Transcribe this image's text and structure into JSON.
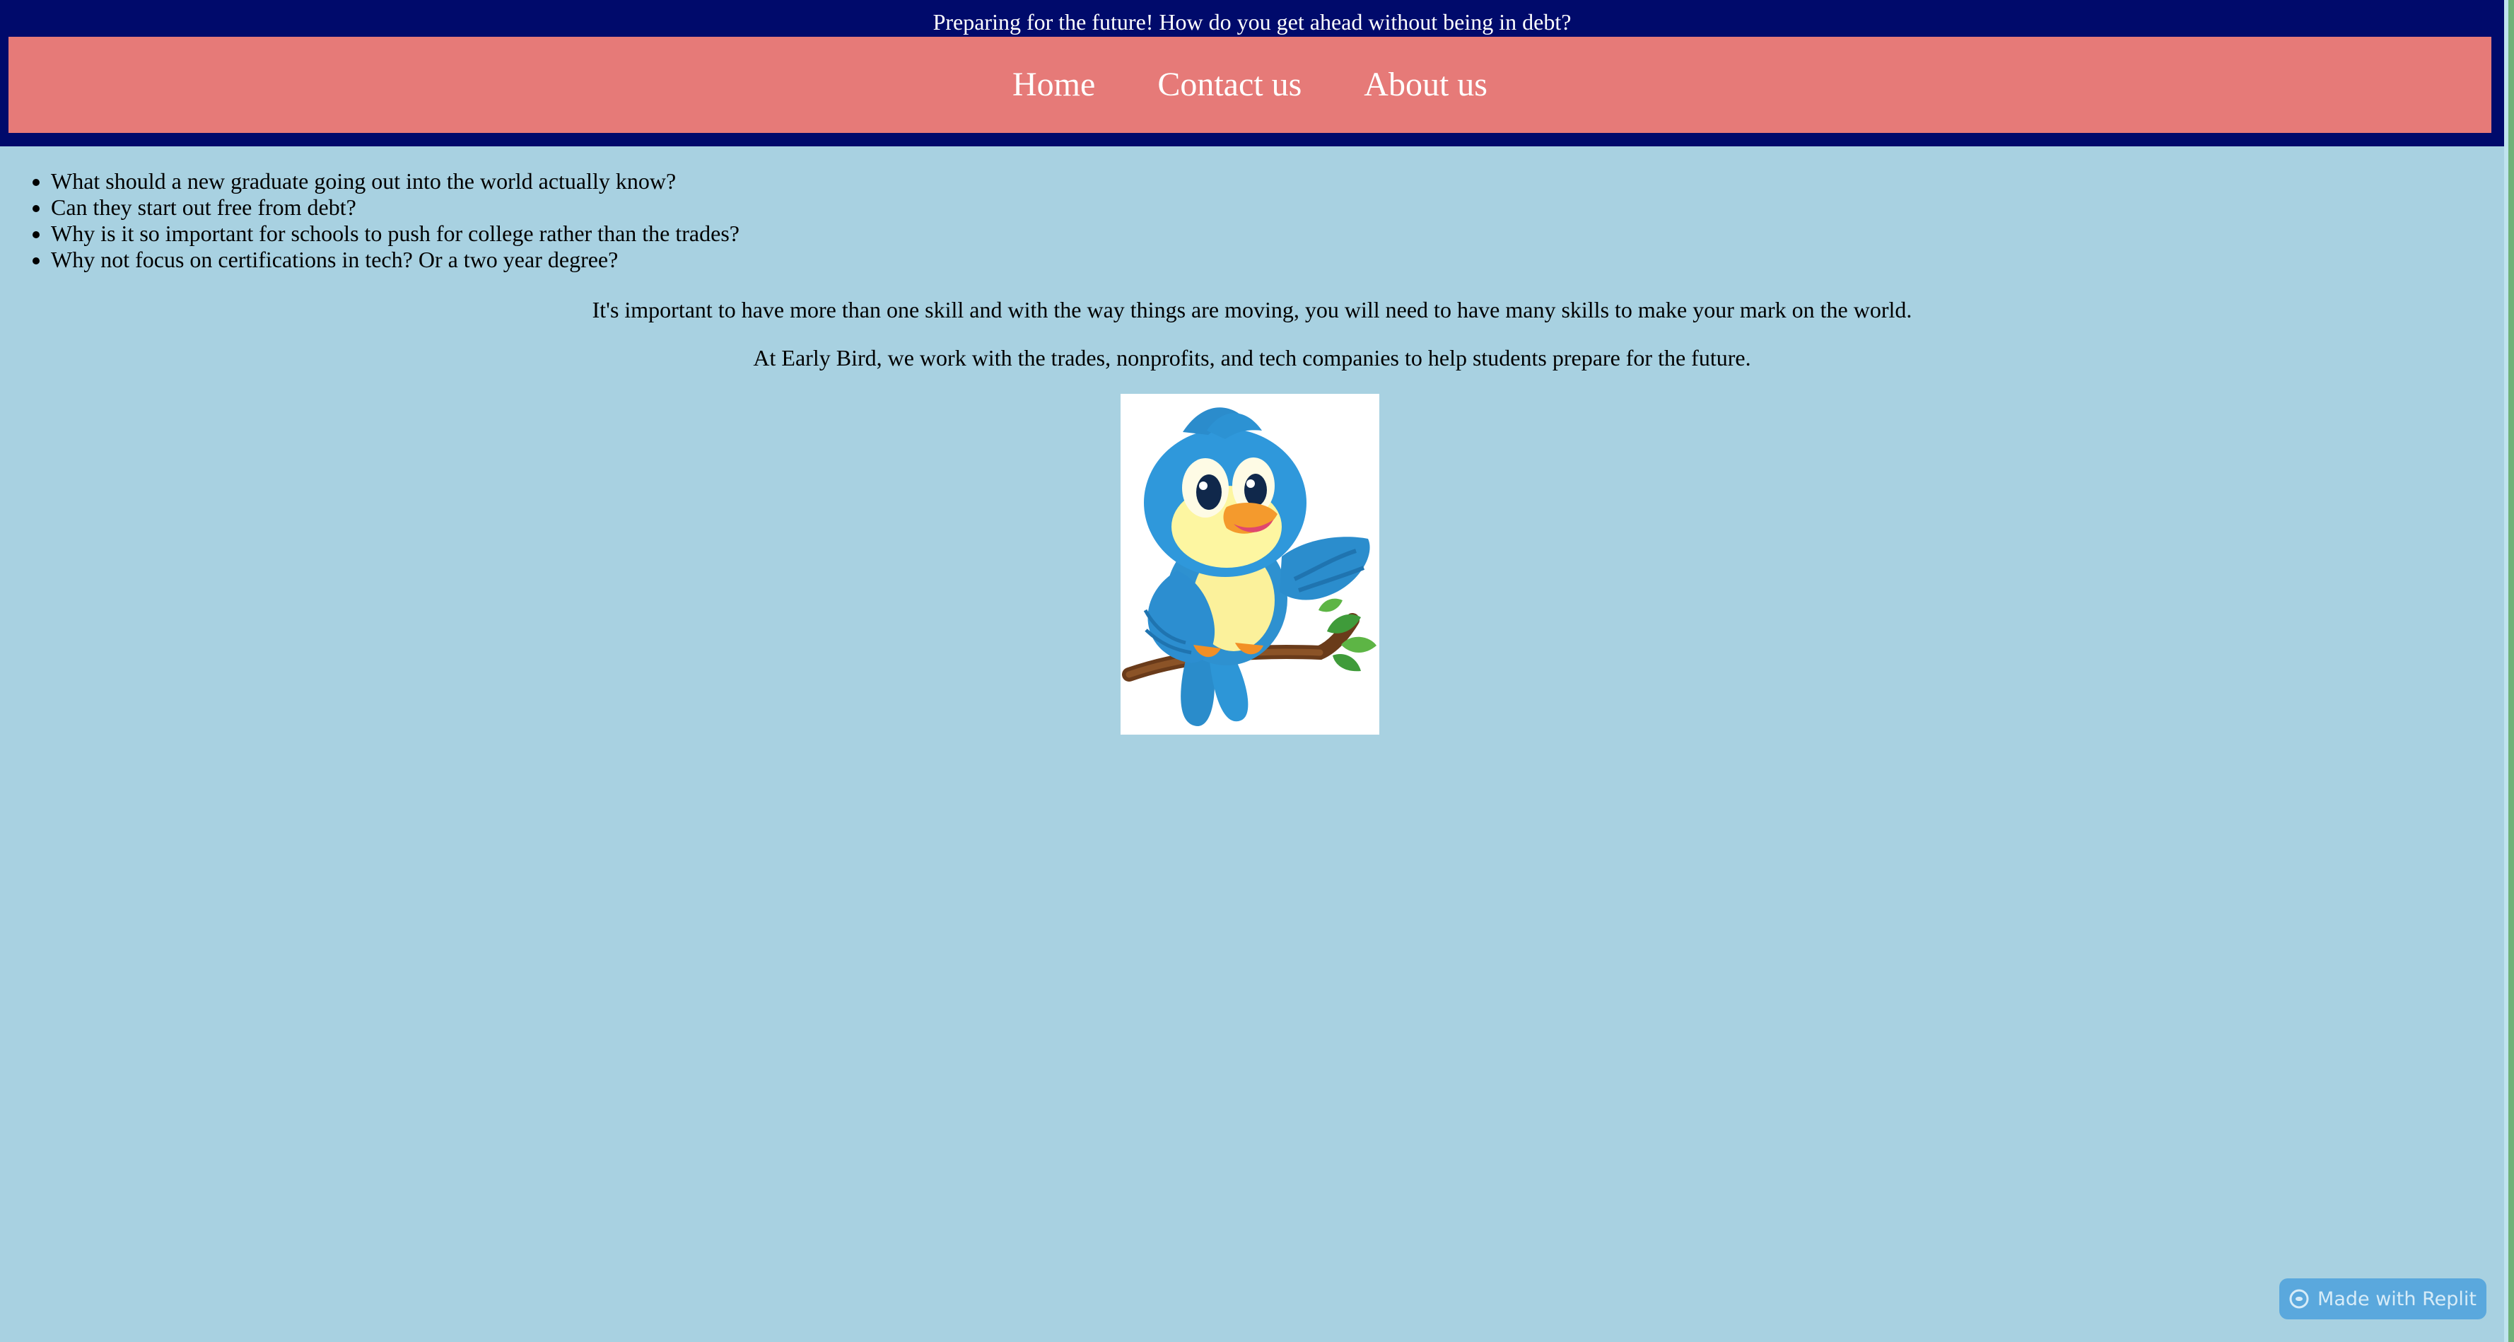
{
  "header": {
    "title": "Preparing for the future! How do you get ahead without being in debt?"
  },
  "nav": {
    "items": [
      {
        "label": "Home"
      },
      {
        "label": "Contact us"
      },
      {
        "label": "About us"
      }
    ]
  },
  "questions": [
    "What should a new graduate going out into the world actually know?",
    "Can they start out free from debt?",
    "Why is it so important for schools to push for college rather than the trades?",
    "Why not focus on certifications in tech? Or a two year degree?"
  ],
  "paragraphs": [
    "It's important to have more than one skill and with the way things are moving, you will need to have many skills to make your mark on the world.",
    "At Early Bird, we work with the trades, nonprofits, and tech companies to help students prepare for the future."
  ],
  "illustration": {
    "name": "blue-bird-on-branch"
  },
  "badge": {
    "label": "Made with Replit",
    "icon": "replit-icon"
  },
  "colors": {
    "page_background": "#a8d1e1",
    "header_background": "#000a6b",
    "nav_background": "#e67a78",
    "nav_text": "#ffffff",
    "badge_background": "#5aa8dd"
  }
}
